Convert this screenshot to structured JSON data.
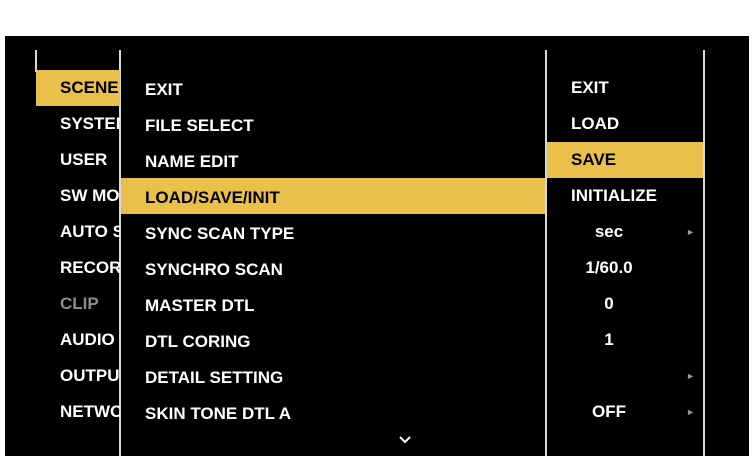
{
  "level1": {
    "items": [
      {
        "label": "SCENE",
        "state": "selected"
      },
      {
        "label": "SYSTEM",
        "state": "normal"
      },
      {
        "label": "USER",
        "state": "normal"
      },
      {
        "label": "SW MODE",
        "state": "normal"
      },
      {
        "label": "AUTO SW",
        "state": "normal"
      },
      {
        "label": "RECORDING",
        "state": "normal"
      },
      {
        "label": "CLIP",
        "state": "disabled"
      },
      {
        "label": "AUDIO",
        "state": "normal"
      },
      {
        "label": "OUTPUT",
        "state": "normal"
      },
      {
        "label": "NETWORK",
        "state": "normal"
      }
    ]
  },
  "level2": {
    "items": [
      {
        "label": "EXIT"
      },
      {
        "label": "FILE SELECT"
      },
      {
        "label": "NAME EDIT"
      },
      {
        "label": "LOAD/SAVE/INIT"
      },
      {
        "label": "SYNC SCAN TYPE"
      },
      {
        "label": "SYNCHRO SCAN"
      },
      {
        "label": "MASTER DTL"
      },
      {
        "label": "DTL CORING"
      },
      {
        "label": "DETAIL SETTING"
      },
      {
        "label": "SKIN TONE DTL A"
      }
    ]
  },
  "level3": {
    "items": [
      {
        "label": "EXIT"
      },
      {
        "label": "LOAD"
      },
      {
        "label": "SAVE"
      },
      {
        "label": "INITIALIZE"
      },
      {
        "label": "sec",
        "has_arrow": true
      },
      {
        "label": "1/60.0"
      },
      {
        "label": "0"
      },
      {
        "label": "1"
      },
      {
        "label": "",
        "has_arrow": true
      },
      {
        "label": "OFF",
        "has_arrow": true
      }
    ],
    "arrow_glyph": "►"
  },
  "colors": {
    "highlight": "#e9c04a",
    "background": "#000000",
    "disabled_text": "#8d8d8d"
  },
  "icons": {
    "scroll_down": "chevron-down-icon",
    "submenu": "triangle-right-icon"
  }
}
